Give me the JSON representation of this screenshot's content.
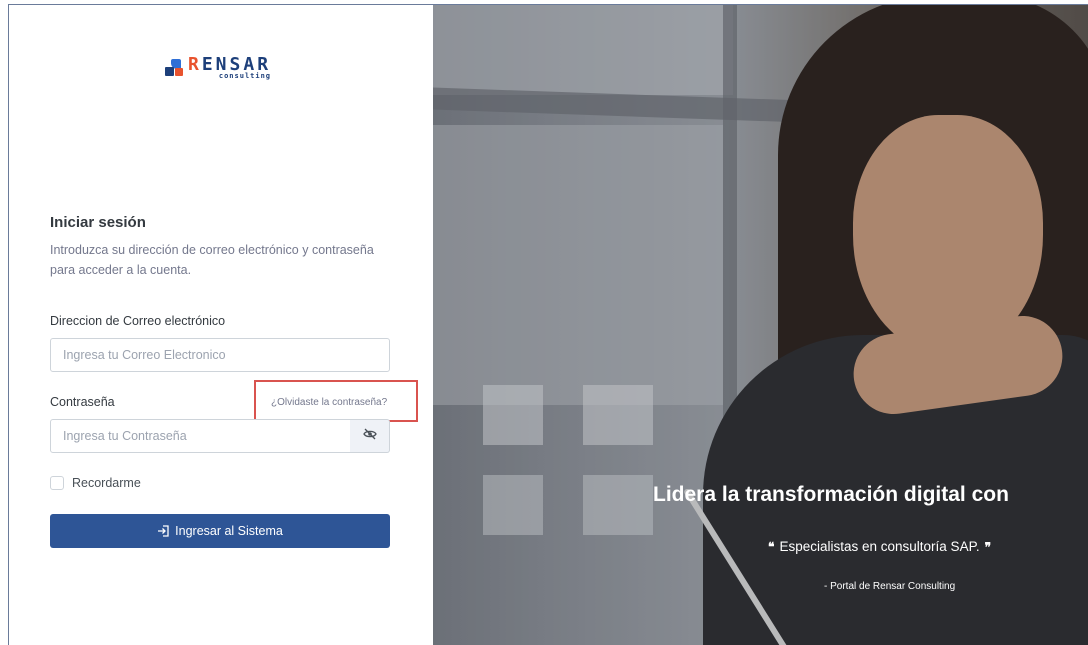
{
  "brand": {
    "logo_word_part1": "R",
    "logo_word_part2": "ENSAR",
    "logo_sub": "consulting"
  },
  "login": {
    "title": "Iniciar sesión",
    "description": "Introduzca su dirección de correo electrónico y contraseña para acceder a la cuenta.",
    "email_label": "Direccion de Correo electrónico",
    "email_placeholder": "Ingresa tu Correo Electronico",
    "email_value": "",
    "password_label": "Contraseña",
    "password_placeholder": "Ingresa tu Contraseña",
    "password_value": "",
    "forgot_link": "¿Olvidaste la contraseña?",
    "remember_label": "Recordarme",
    "remember_checked": false,
    "submit_label": "Ingresar al Sistema",
    "eye_icon": "eye-slash-icon",
    "submit_icon": "login-icon"
  },
  "hero": {
    "headline": "Lidera la transformación digital con",
    "quote": "Especialistas en consultoría SAP.",
    "attribution": "- Portal de Rensar Consulting"
  },
  "colors": {
    "primary": "#2e5596",
    "highlight_box": "#d9534f",
    "brand_blue": "#1d3f7a",
    "brand_orange": "#e8532e"
  }
}
